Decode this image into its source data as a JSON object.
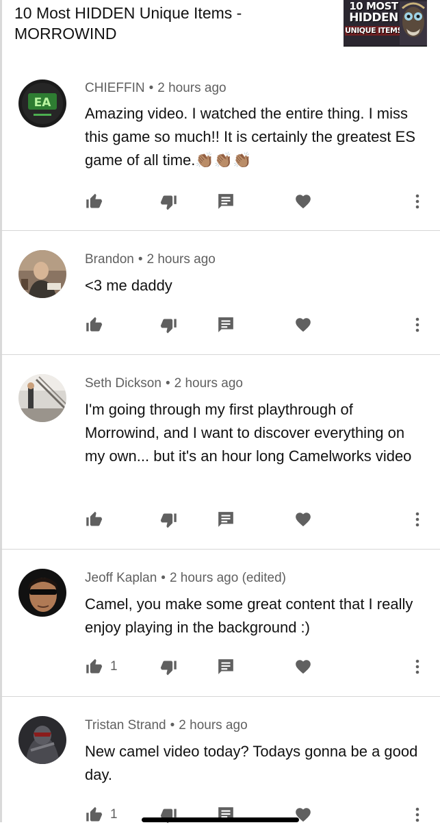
{
  "video": {
    "title": "10 Most HIDDEN Unique Items - MORROWIND",
    "thumbnail": {
      "line1": "10 MOST",
      "line2": "HIDDEN",
      "line3": "UNIQUE ITEMS"
    }
  },
  "comments": [
    {
      "author": "CHIEFFIN",
      "time": "2 hours ago",
      "text": "Amazing video. I watched the entire thing. I miss this game so much!! It is certainly the greatest ES game of all time.",
      "emoji": "👏🏽👏🏽👏🏽",
      "likes": ""
    },
    {
      "author": "Brandon",
      "time": "2 hours ago",
      "text": "<3 me daddy",
      "emoji": "",
      "likes": ""
    },
    {
      "author": "Seth Dickson",
      "time": "2 hours ago",
      "text": "I'm going through my first playthrough of Morrowind, and I want to discover everything on my own... but it's an hour long Camelworks video",
      "emoji": "",
      "likes": ""
    },
    {
      "author": "Jeoff Kaplan",
      "time": "2 hours ago (edited)",
      "text": "Camel, you make some great content that I really enjoy playing in the background :)",
      "emoji": "",
      "likes": "1"
    },
    {
      "author": "Tristan Strand",
      "time": "2 hours ago",
      "text": "New camel video today? Todays gonna be a good day.",
      "emoji": "",
      "likes": "1"
    }
  ],
  "icons": {
    "like": "thumbs-up-icon",
    "dislike": "thumbs-down-icon",
    "reply": "reply-comment-icon",
    "heart": "heart-icon",
    "more": "more-vertical-icon"
  },
  "colors": {
    "icon": "#606060",
    "meta_text": "#606060",
    "divider": "#d6d6d6"
  }
}
